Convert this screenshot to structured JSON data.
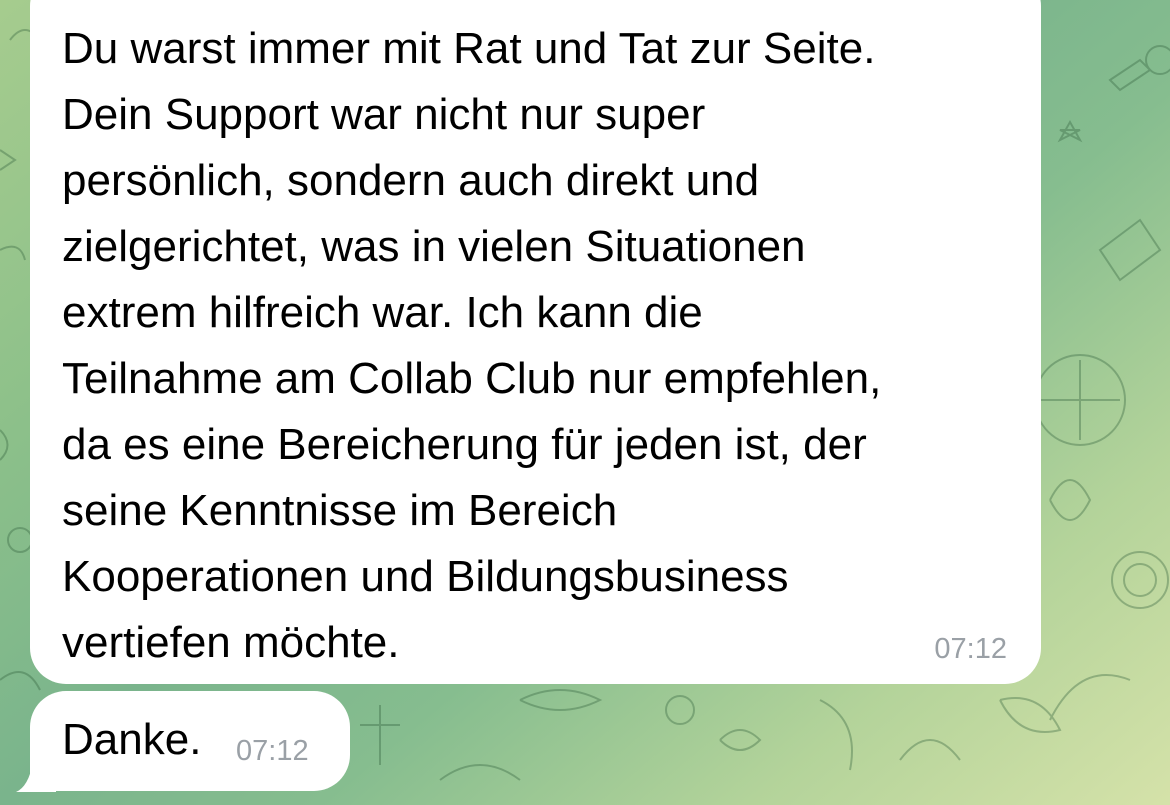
{
  "messages": [
    {
      "text": "Du warst immer mit Rat und Tat zur Seite.\nDein Support war nicht nur super\npersönlich, sondern auch direkt und\nzielgerichtet, was in vielen Situationen\nextrem hilfreich war. Ich kann die\nTeilnahme am Collab Club nur empfehlen,\nda es eine Bereicherung für jeden ist, der\nseine Kenntnisse im Bereich\nKooperationen und Bildungsbusiness\nvertiefen möchte.",
      "time": "07:12"
    },
    {
      "text": "Danke.",
      "time": "07:12"
    }
  ],
  "colors": {
    "bubble": "#ffffff",
    "text": "#000000",
    "time": "#9aa0a6",
    "background_start": "#a6cc8e",
    "background_end": "#d5e2a9"
  }
}
